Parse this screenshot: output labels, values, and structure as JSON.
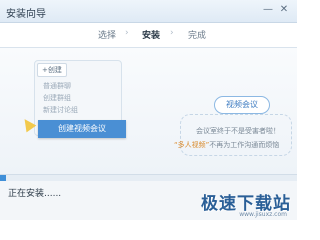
{
  "window": {
    "title": "安装向导",
    "minimize_symbol": "—",
    "close_symbol": "✕"
  },
  "steps": [
    {
      "label": "选择",
      "state": "done"
    },
    {
      "label": "安装",
      "state": "active"
    },
    {
      "label": "完成",
      "state": "pending"
    }
  ],
  "illustration": {
    "mock_panel": {
      "tag": "+创建",
      "items": [
        "普通群聊",
        "创建群组",
        "新建讨论组"
      ]
    },
    "highlight_item": "创建视频会议",
    "bubble": "视频会议",
    "tip_line_1": "会议室终于不是受害者啦！",
    "tip_line_2_em": "“多人视频”",
    "tip_line_2_rest": "不再为工作沟通而烦恼"
  },
  "progress": {
    "fraction": 0.02,
    "color": "#3f8fd8"
  },
  "status": {
    "text": "正在安装......"
  },
  "watermark": {
    "text": "极速下载站",
    "url": "www.jisuxz.com"
  }
}
